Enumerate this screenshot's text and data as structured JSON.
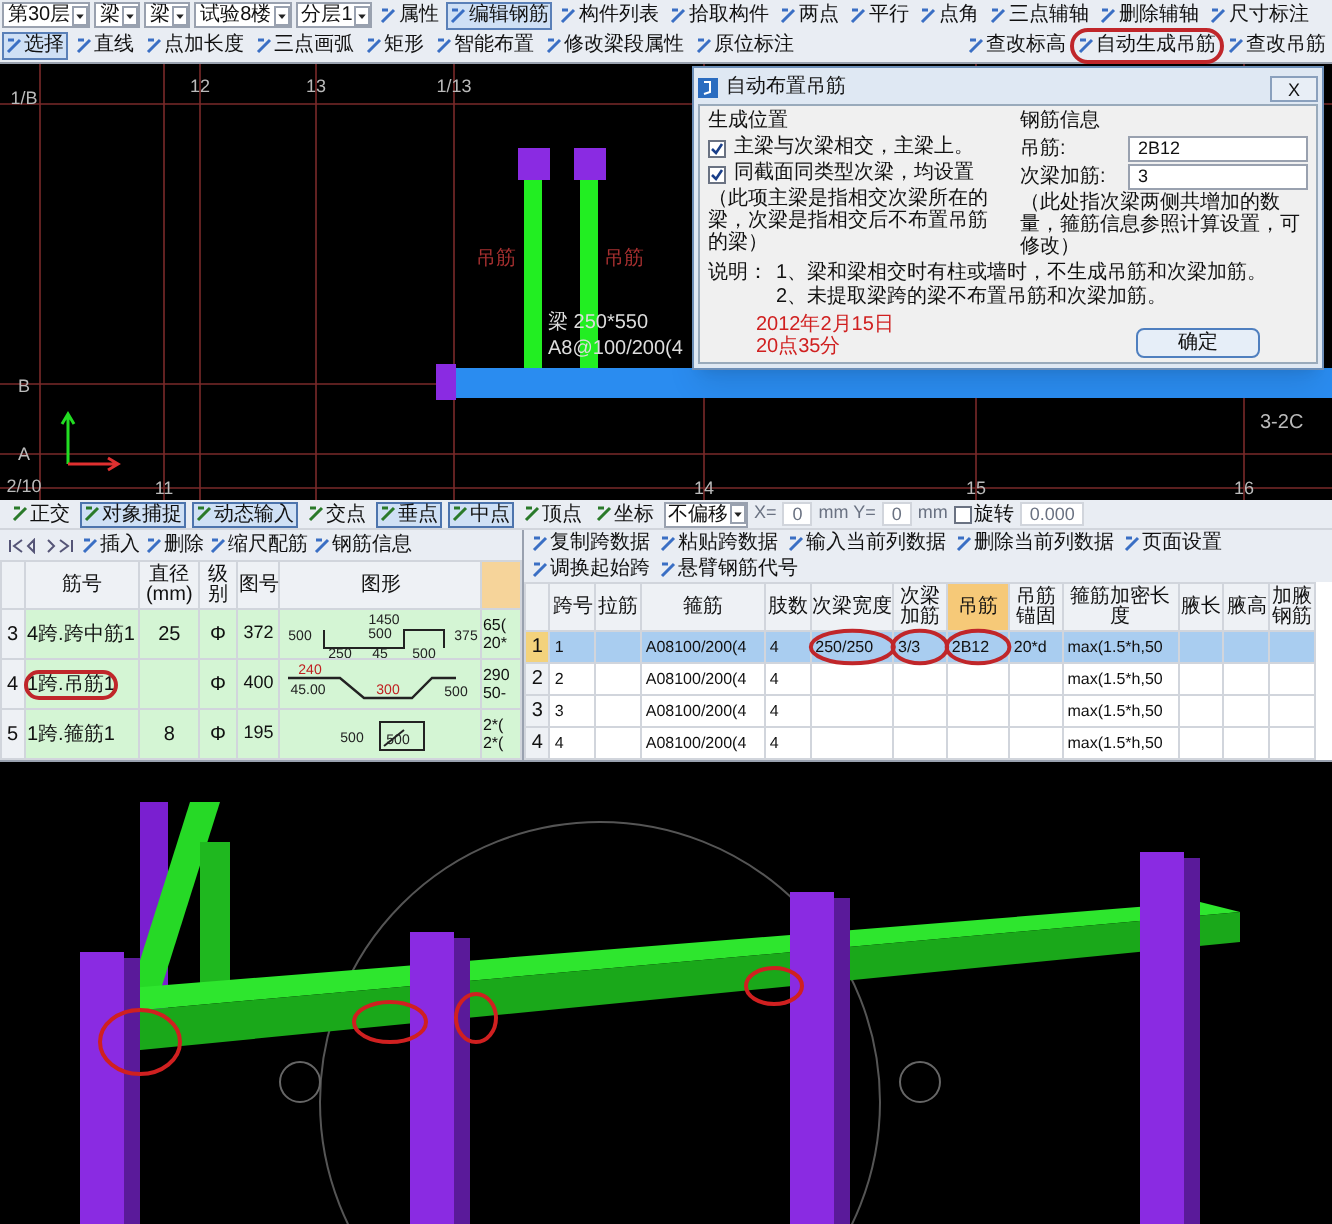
{
  "toolbar": {
    "top_row": [
      {
        "kind": "dropdown",
        "label": "第30层"
      },
      {
        "kind": "dropdown",
        "label": "梁"
      },
      {
        "kind": "dropdown",
        "label": "梁"
      },
      {
        "kind": "dropdown",
        "label": "试验8楼"
      },
      {
        "kind": "dropdown",
        "label": "分层1"
      },
      {
        "kind": "tool",
        "label": "属性",
        "selected": false
      },
      {
        "kind": "tool",
        "label": "编辑钢筋",
        "selected": true
      },
      {
        "kind": "tool",
        "label": "构件列表",
        "selected": false
      },
      {
        "kind": "tool",
        "label": "拾取构件",
        "selected": false
      },
      {
        "kind": "tool",
        "label": "两点",
        "selected": false
      },
      {
        "kind": "tool",
        "label": "平行",
        "selected": false
      },
      {
        "kind": "tool",
        "label": "点角",
        "selected": false
      },
      {
        "kind": "tool",
        "label": "三点辅轴",
        "selected": false
      },
      {
        "kind": "tool",
        "label": "删除辅轴",
        "selected": false
      },
      {
        "kind": "tool",
        "label": "尺寸标注",
        "selected": false
      }
    ],
    "bottom_row": [
      {
        "kind": "tool",
        "label": "选择",
        "selected": true
      },
      {
        "kind": "tool",
        "label": "直线",
        "selected": false
      },
      {
        "kind": "tool",
        "label": "点加长度",
        "selected": false
      },
      {
        "kind": "tool",
        "label": "三点画弧",
        "selected": false
      },
      {
        "kind": "tool",
        "label": "矩形",
        "selected": false
      },
      {
        "kind": "tool",
        "label": "智能布置",
        "selected": false
      },
      {
        "kind": "tool",
        "label": "修改梁段属性",
        "selected": false
      },
      {
        "kind": "tool",
        "label": "原位标注",
        "selected": false
      },
      {
        "kind": "spacer"
      },
      {
        "kind": "tool",
        "label": "查改标高",
        "selected": false
      },
      {
        "kind": "tool",
        "label": "自动生成吊筋",
        "selected": false,
        "circled": true
      },
      {
        "kind": "tool",
        "label": "查改吊筋",
        "selected": false
      }
    ]
  },
  "canvas": {
    "axis_labels": [
      "12",
      "13",
      "1/13",
      "1/B",
      "B",
      "A",
      "2/10",
      "11",
      "14",
      "15",
      "16"
    ],
    "beam_name": "梁 250*550",
    "beam_rebar": "A8@100/200(4",
    "column_labels": [
      "吊筋",
      "吊筋"
    ],
    "span_label": "3-2C"
  },
  "dialog": {
    "title": "自动布置吊筋",
    "close": "X",
    "position_group": {
      "title": "生成位置",
      "options": [
        {
          "label": "主梁与次梁相交，主梁上。",
          "checked": true
        },
        {
          "label": "同截面同类型次梁，均设置",
          "checked": true
        }
      ],
      "note": "（此项主梁是指相交次梁所在的梁，次梁是指相交后不布置吊筋的梁）"
    },
    "rebar_group": {
      "title": "钢筋信息",
      "fields": [
        {
          "label": "吊筋:",
          "value": "2B12"
        },
        {
          "label": "次梁加筋:",
          "value": "3"
        }
      ],
      "note": "（此处指次梁两侧共增加的数量，箍筋信息参照计算设置，可修改）"
    },
    "remarks_label": "说明：",
    "remarks": [
      "1、梁和梁相交时有柱或墙时，不生成吊筋和次梁加筋。",
      "2、未提取梁跨的梁不布置吊筋和次梁加筋。"
    ],
    "stamp": [
      "2012年2月15日",
      "20点35分"
    ],
    "ok_button": "确定"
  },
  "snap_bar": [
    {
      "kind": "toggle",
      "label": "正交",
      "selected": false
    },
    {
      "kind": "toggle",
      "label": "对象捕捉",
      "selected": true
    },
    {
      "kind": "toggle",
      "label": "动态输入",
      "selected": true
    },
    {
      "kind": "toggle",
      "label": "交点",
      "selected": false
    },
    {
      "kind": "toggle",
      "label": "垂点",
      "selected": true
    },
    {
      "kind": "toggle",
      "label": "中点",
      "selected": true
    },
    {
      "kind": "toggle",
      "label": "顶点",
      "selected": false
    },
    {
      "kind": "toggle",
      "label": "坐标",
      "selected": false
    },
    {
      "kind": "dropdown",
      "label": "不偏移"
    },
    {
      "kind": "text",
      "label": "X="
    },
    {
      "kind": "field",
      "label": "0"
    },
    {
      "kind": "text",
      "label": "mm Y="
    },
    {
      "kind": "field",
      "label": "0"
    },
    {
      "kind": "text",
      "label": "mm"
    },
    {
      "kind": "check",
      "label": "旋转",
      "checked": false
    },
    {
      "kind": "field",
      "label": "0.000"
    }
  ],
  "rebar_panel": {
    "toolbar": [
      "插入",
      "删除",
      "缩尺配筋",
      "钢筋信息"
    ],
    "columns": [
      "筋号",
      "直径(mm)",
      "级别",
      "图号",
      "图形"
    ],
    "rows": [
      {
        "num": "3",
        "name": "4跨.跨中筋1",
        "diameter": "25",
        "grade": "Φ",
        "shape_no": "372",
        "shape": {
          "kind": "u_bend",
          "labels": [
            "1450",
            "500",
            "500",
            "375",
            "250",
            "45",
            "500"
          ]
        },
        "extra": [
          "65(",
          "20*"
        ],
        "circled": false
      },
      {
        "num": "4",
        "name": "1跨.吊筋1",
        "grade": "Φ",
        "shape_no": "400",
        "shape": {
          "kind": "hanger",
          "labels": [
            "240",
            "45.00",
            "300",
            "500"
          ]
        },
        "extra": [
          "290",
          "50-"
        ],
        "circled": true
      },
      {
        "num": "5",
        "name": "1跨.箍筋1",
        "diameter": "8",
        "grade": "Φ",
        "shape_no": "195",
        "shape": {
          "kind": "stirrup",
          "labels": [
            "500",
            "500"
          ]
        },
        "extra": [
          "2*(",
          "2*("
        ],
        "circled": false
      }
    ]
  },
  "span_panel": {
    "toolbar": [
      "复制跨数据",
      "粘贴跨数据",
      "输入当前列数据",
      "删除当前列数据",
      "页面设置",
      "调换起始跨",
      "悬臂钢筋代号"
    ],
    "columns": [
      "跨号",
      "拉筋",
      "箍筋",
      "肢数",
      "次梁宽度",
      "次梁加筋",
      "吊筋",
      "吊筋锚固",
      "箍筋加密长度",
      "腋长",
      "腋高",
      "加腋钢筋"
    ],
    "rows": [
      {
        "num": "1",
        "selected": true,
        "circled": [
          false,
          false,
          false,
          false,
          true,
          true,
          true,
          false,
          false,
          false,
          false,
          false
        ],
        "cells": [
          "1",
          null,
          "A08100/200(4",
          "4",
          "250/250",
          "3/3",
          "2B12",
          "20*d",
          "max(1.5*h,50",
          null,
          null,
          null
        ]
      },
      {
        "num": "2",
        "selected": false,
        "circled": [
          false,
          false,
          false,
          false,
          false,
          false,
          false,
          false,
          false,
          false,
          false,
          false
        ],
        "cells": [
          "2",
          null,
          "A08100/200(4",
          "4",
          null,
          null,
          null,
          null,
          "max(1.5*h,50",
          null,
          null,
          null
        ]
      },
      {
        "num": "3",
        "selected": false,
        "circled": [
          false,
          false,
          false,
          false,
          false,
          false,
          false,
          false,
          false,
          false,
          false,
          false
        ],
        "cells": [
          "3",
          null,
          "A08100/200(4",
          "4",
          null,
          null,
          null,
          null,
          "max(1.5*h,50",
          null,
          null,
          null
        ]
      },
      {
        "num": "4",
        "selected": false,
        "circled": [
          false,
          false,
          false,
          false,
          false,
          false,
          false,
          false,
          false,
          false,
          false,
          false
        ],
        "cells": [
          "4",
          null,
          "A08100/200(4",
          "4",
          null,
          null,
          null,
          null,
          "max(1.5*h,50",
          null,
          null,
          null
        ]
      }
    ]
  }
}
